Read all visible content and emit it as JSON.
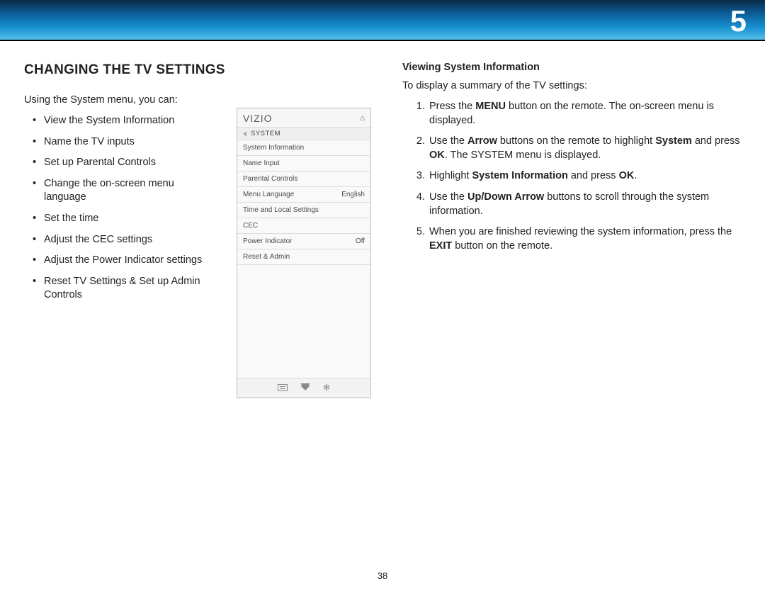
{
  "chapter_number": "5",
  "page_number": "38",
  "left": {
    "heading": "CHANGING THE TV SETTINGS",
    "intro": "Using the System menu, you can:",
    "bullets": [
      "View the System Information",
      "Name the TV inputs",
      "Set up Parental Controls",
      "Change the on-screen menu language",
      "Set the time",
      "Adjust the CEC settings",
      "Adjust the Power Indicator settings",
      "Reset TV Settings & Set up Admin Controls"
    ]
  },
  "tvmenu": {
    "brand": "VIZIO",
    "breadcrumb": "SYSTEM",
    "rows": [
      {
        "label": "System Information",
        "value": ""
      },
      {
        "label": "Name Input",
        "value": ""
      },
      {
        "label": "Parental Controls",
        "value": ""
      },
      {
        "label": "Menu Language",
        "value": "English"
      },
      {
        "label": "Time and Local Settings",
        "value": ""
      },
      {
        "label": "CEC",
        "value": ""
      },
      {
        "label": "Power Indicator",
        "value": "Off"
      },
      {
        "label": "Reset & Admin",
        "value": ""
      }
    ]
  },
  "right": {
    "heading": "Viewing System Information",
    "intro": "To display a summary of the TV settings:",
    "steps": {
      "s1a": "Press the ",
      "s1b": "MENU",
      "s1c": " button on the remote. The on-screen menu is displayed.",
      "s2a": "Use the ",
      "s2b": "Arrow",
      "s2c": " buttons on the remote to highlight ",
      "s2d": "System",
      "s2e": " and press ",
      "s2f": "OK",
      "s2g": ". The SYSTEM menu is displayed.",
      "s3a": "Highlight ",
      "s3b": "System Information",
      "s3c": " and press ",
      "s3d": "OK",
      "s3e": ".",
      "s4a": "Use the ",
      "s4b": "Up/Down Arrow",
      "s4c": " buttons to scroll through the system information.",
      "s5a": "When you are finished reviewing the system information, press the ",
      "s5b": "EXIT",
      "s5c": " button on the remote."
    }
  }
}
